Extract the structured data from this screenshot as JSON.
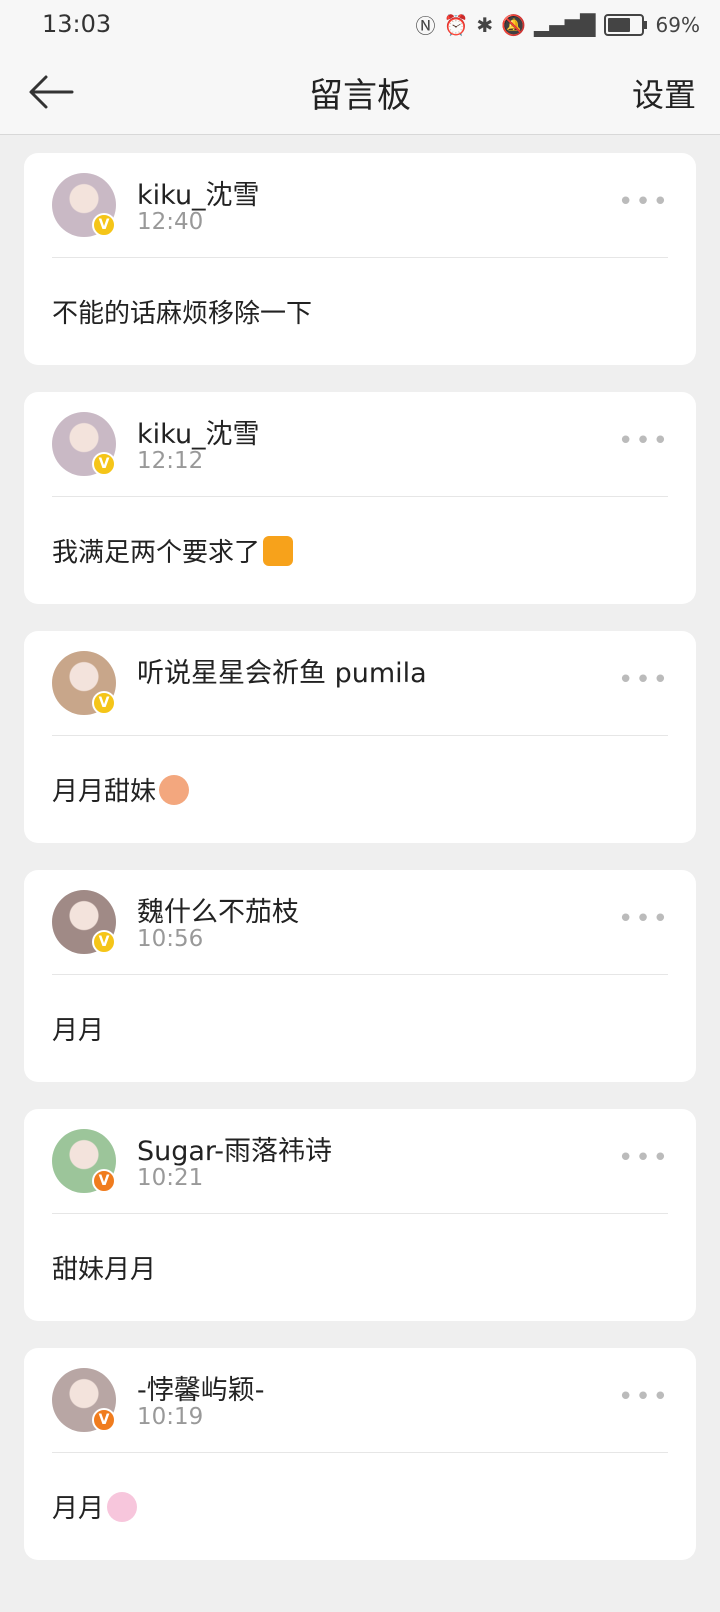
{
  "status": {
    "time": "13:03",
    "battery_pct": "69%",
    "battery_level": 0.69,
    "icons": [
      "nfc-icon",
      "alarm-icon",
      "bluetooth-icon",
      "mute-icon",
      "signal-4g-icon"
    ]
  },
  "nav": {
    "title": "留言板",
    "settings_label": "设置"
  },
  "messages": [
    {
      "name": "kiku_沈雪",
      "time": "12:40",
      "text": "不能的话麻烦移除一下",
      "avatar_color": "#c9b9c5",
      "badge_color": "#f5c518",
      "emoji": ""
    },
    {
      "name": "kiku_沈雪",
      "time": "12:12",
      "text": "我满足两个要求了",
      "avatar_color": "#c9b9c5",
      "badge_color": "#f5c518",
      "emoji": "moon-emoji"
    },
    {
      "name": "听说星星会祈鱼 pumila",
      "time": "",
      "text": "月月甜妹",
      "avatar_color": "#c8a68a",
      "badge_color": "#f5c518",
      "emoji": "cute-face-emoji"
    },
    {
      "name": "魏什么不茄枝",
      "time": "10:56",
      "text": "月月",
      "avatar_color": "#a08a86",
      "badge_color": "#f5c518",
      "emoji": ""
    },
    {
      "name": "Sugar-雨落祎诗",
      "time": "10:21",
      "text": "甜妹月月",
      "avatar_color": "#9cc59a",
      "badge_color": "#f07c1e",
      "emoji": ""
    },
    {
      "name": "-悖馨屿颖-",
      "time": "10:19",
      "text": "月月",
      "avatar_color": "#b8a6a4",
      "badge_color": "#f07c1e",
      "emoji": "bunny-emoji"
    }
  ]
}
